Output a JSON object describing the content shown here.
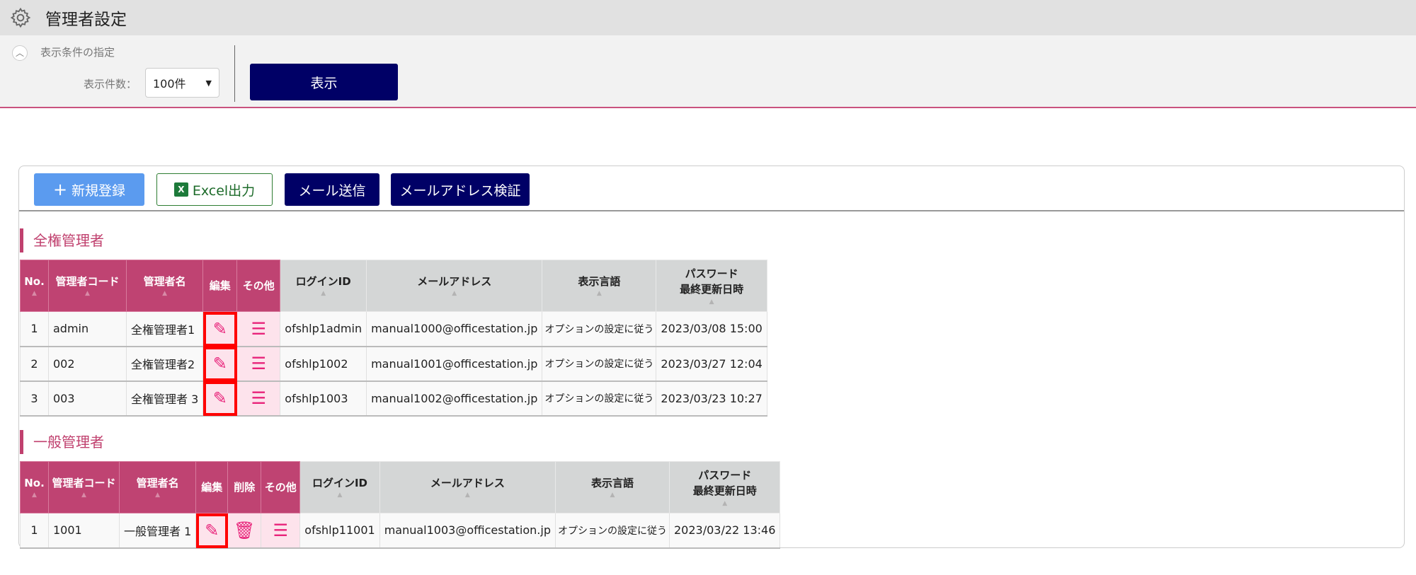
{
  "header": {
    "title": "管理者設定"
  },
  "filter": {
    "section_title": "表示条件の指定",
    "count_label": "表示件数：",
    "count_value": "100件",
    "show_button": "表示"
  },
  "toolbar": {
    "new": "新規登録",
    "excel": "Excel出力",
    "mail": "メール送信",
    "verify": "メールアドレス検証"
  },
  "full_admins": {
    "title": "全権管理者",
    "headers": [
      "No.",
      "管理者コード",
      "管理者名",
      "編集",
      "その他",
      "ログインID",
      "メールアドレス",
      "表示言語",
      "パスワード",
      "最終更新日時"
    ],
    "rows": [
      {
        "no": "1",
        "code": "admin",
        "name": "全権管理者1",
        "login": "ofshlp1admin",
        "email": "manual1000@officestation.jp",
        "lang": "オプションの設定に従う",
        "updated": "2023/03/08 15:00"
      },
      {
        "no": "2",
        "code": "002",
        "name": "全権管理者2",
        "login": "ofshlp1002",
        "email": "manual1001@officestation.jp",
        "lang": "オプションの設定に従う",
        "updated": "2023/03/27 12:04"
      },
      {
        "no": "3",
        "code": "003",
        "name": "全権管理者 3",
        "login": "ofshlp1003",
        "email": "manual1002@officestation.jp",
        "lang": "オプションの設定に従う",
        "updated": "2023/03/23 10:27"
      }
    ]
  },
  "general_admins": {
    "title": "一般管理者",
    "headers": [
      "No.",
      "管理者コード",
      "管理者名",
      "編集",
      "削除",
      "その他",
      "ログインID",
      "メールアドレス",
      "表示言語",
      "パスワード",
      "最終更新日時"
    ],
    "rows": [
      {
        "no": "1",
        "code": "1001",
        "name": "一般管理者 1",
        "login": "ofshlp11001",
        "email": "manual1003@officestation.jp",
        "lang": "オプションの設定に従う",
        "updated": "2023/03/22 13:46"
      }
    ]
  },
  "colors": {
    "accent": "#bf4372",
    "navy": "#000066",
    "blue": "#5b9bef",
    "highlight": "#ff0000"
  }
}
